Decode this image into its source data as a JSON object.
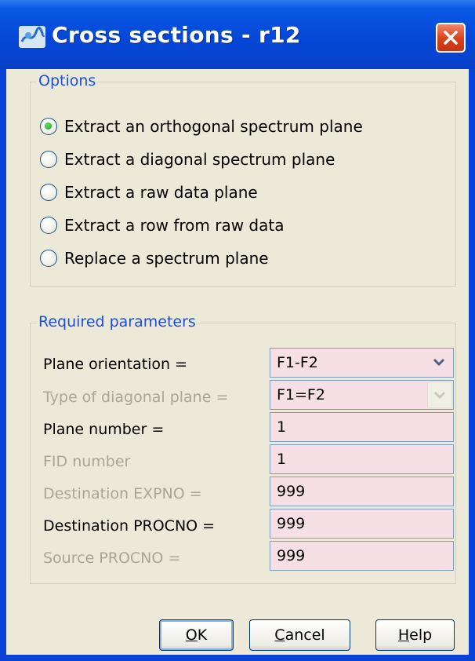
{
  "window": {
    "title": "Cross sections - r12",
    "icon": "app-logo-icon",
    "close_icon": "close-icon",
    "accent_color": "#0a43d6"
  },
  "options": {
    "legend": "Options",
    "items": [
      {
        "label": "Extract an orthogonal spectrum plane",
        "checked": true
      },
      {
        "label": "Extract a diagonal spectrum plane",
        "checked": false
      },
      {
        "label": "Extract a raw data plane",
        "checked": false
      },
      {
        "label": "Extract a row from raw data",
        "checked": false
      },
      {
        "label": "Replace a spectrum plane",
        "checked": false
      }
    ]
  },
  "params": {
    "legend": "Required parameters",
    "rows": [
      {
        "label": "Plane orientation =",
        "value": "F1-F2",
        "enabled": true,
        "type": "select"
      },
      {
        "label": "Type of diagonal plane =",
        "value": "F1=F2",
        "enabled": false,
        "type": "select"
      },
      {
        "label": "Plane number =",
        "value": "1",
        "enabled": true,
        "type": "text"
      },
      {
        "label": "FID number",
        "value": "1",
        "enabled": false,
        "type": "text"
      },
      {
        "label": "Destination EXPNO =",
        "value": "999",
        "enabled": false,
        "type": "text"
      },
      {
        "label": "Destination PROCNO =",
        "value": "999",
        "enabled": true,
        "type": "text"
      },
      {
        "label": "Source PROCNO =",
        "value": "999",
        "enabled": false,
        "type": "text"
      }
    ]
  },
  "buttons": {
    "ok": {
      "mnemonic": "O",
      "rest": "K"
    },
    "cancel": {
      "mnemonic": "C",
      "rest": "ancel"
    },
    "help": {
      "mnemonic": "H",
      "rest": "elp"
    }
  }
}
